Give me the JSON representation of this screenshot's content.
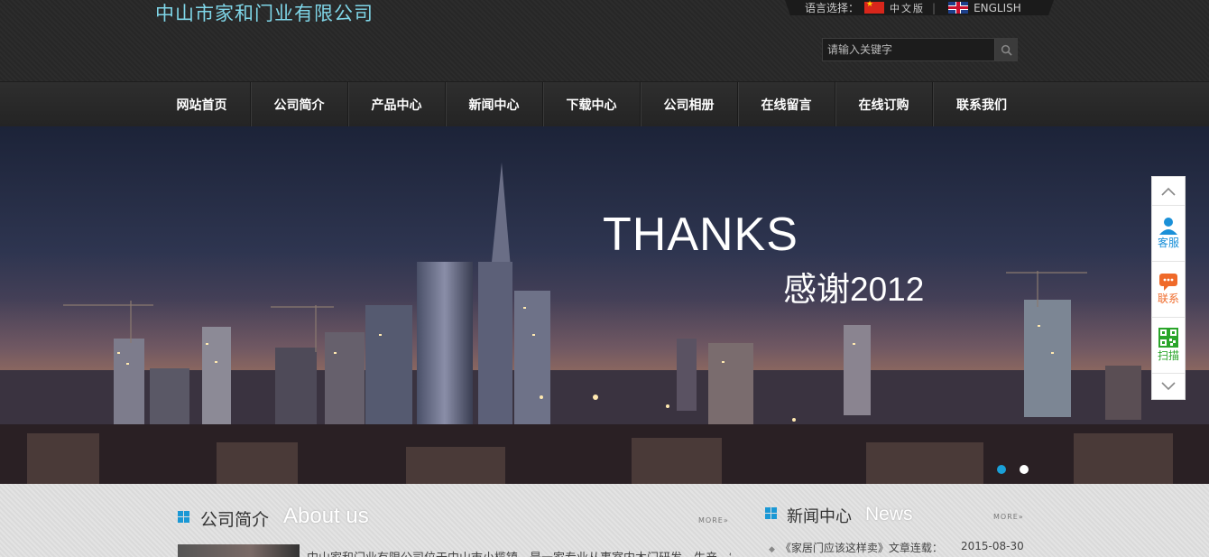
{
  "header": {
    "company_name": "中山市家和门业有限公司",
    "language_label": "语言选择：",
    "lang_cn": "中文版",
    "lang_en": "ENGLISH",
    "search_placeholder": "请输入关键字"
  },
  "nav": {
    "items": [
      "网站首页",
      "公司简介",
      "产品中心",
      "新闻中心",
      "下载中心",
      "公司相册",
      "在线留言",
      "在线订购",
      "联系我们"
    ]
  },
  "banner": {
    "title": "THANKS",
    "subtitle": "感谢2012"
  },
  "side_float": {
    "service": "客服",
    "contact": "联系",
    "scan": "扫描"
  },
  "about": {
    "title_cn": "公司简介",
    "title_en": "About us",
    "more": "MORE»",
    "text": "中山家和门业有限公司位于中山市小榄镇，是一家专业从事室内木门研发、生产、销售"
  },
  "news": {
    "title_cn": "新闻中心",
    "title_en": "News",
    "more": "MORE»",
    "items": [
      {
        "title": "《家居门应该这样卖》文章连载：",
        "date": "2015-08-30"
      }
    ]
  },
  "colors": {
    "accent": "#1a98d5",
    "logo_text": "#7fd6e8",
    "header_bg": "#2a2a2a"
  }
}
